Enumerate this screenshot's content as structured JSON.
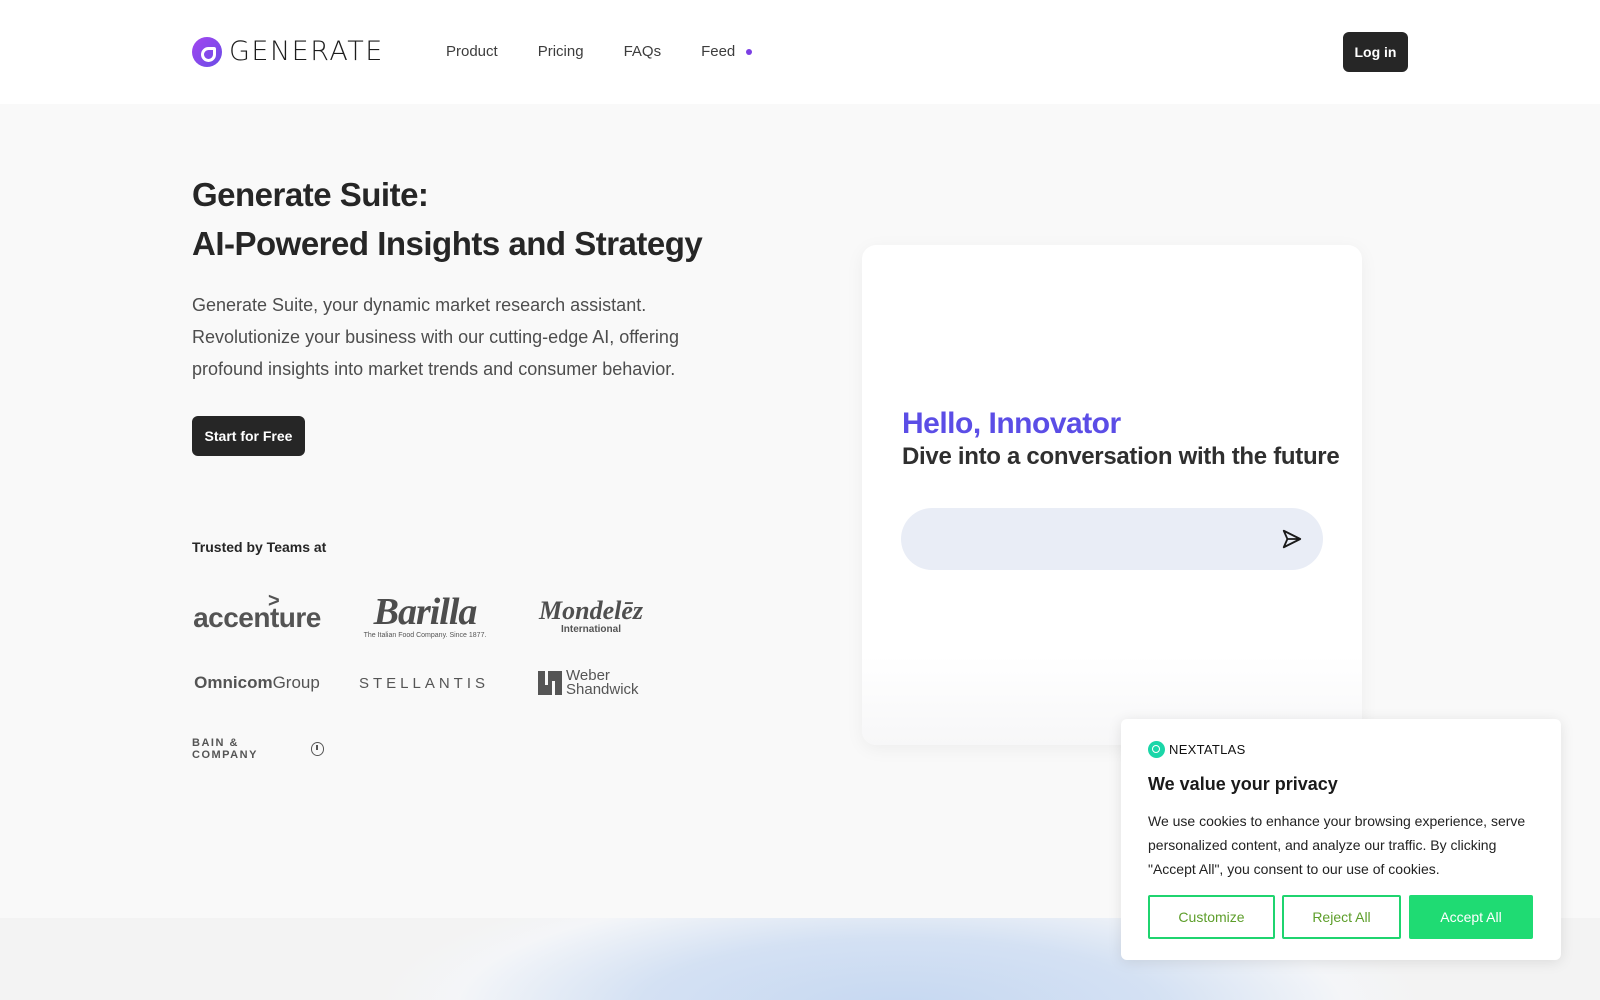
{
  "header": {
    "brand": "GENERATE",
    "nav": [
      "Product",
      "Pricing",
      "FAQs",
      "Feed"
    ],
    "login_label": "Log in"
  },
  "hero": {
    "title_line1": "Generate Suite:",
    "title_line2": "AI-Powered Insights and Strategy",
    "description": "Generate Suite, your dynamic market research assistant. Revolutionize your business with our cutting-edge AI, offering profound insights into market trends and consumer behavior.",
    "cta_label": "Start for Free",
    "trusted_label": "Trusted by Teams at"
  },
  "logos": {
    "accenture": "accenture",
    "barilla": "Barilla",
    "barilla_tagline": "The Italian Food Company. Since 1877.",
    "mondelez": "Mondelēz",
    "mondelez_sub": "International",
    "omnicom_bold": "Omnicom",
    "omnicom_rest": "Group",
    "stellantis": "STELLANTIS",
    "weber_line1": "Weber",
    "weber_line2": "Shandwick",
    "bain": "BAIN & COMPANY"
  },
  "chat": {
    "greeting": "Hello, Innovator",
    "subtitle": "Dive into a conversation with the future",
    "input_value": "",
    "input_placeholder": ""
  },
  "cookie": {
    "brand": "NEXTATLAS",
    "title": "We value your privacy",
    "text": "We use cookies to enhance your browsing experience, serve personalized content, and analyze our traffic. By clicking \"Accept All\", you consent to our use of cookies.",
    "customize_label": "Customize",
    "reject_label": "Reject All",
    "accept_label": "Accept All"
  },
  "colors": {
    "accent": "#5b4de6",
    "nav_dot": "#7b3fe4",
    "cookie_green": "#1fdb73",
    "dark_button": "#262626"
  },
  "icons": {
    "send": "send-icon",
    "logo": "generate-logo-icon",
    "cookie_brand": "nextatlas-logo-icon"
  }
}
